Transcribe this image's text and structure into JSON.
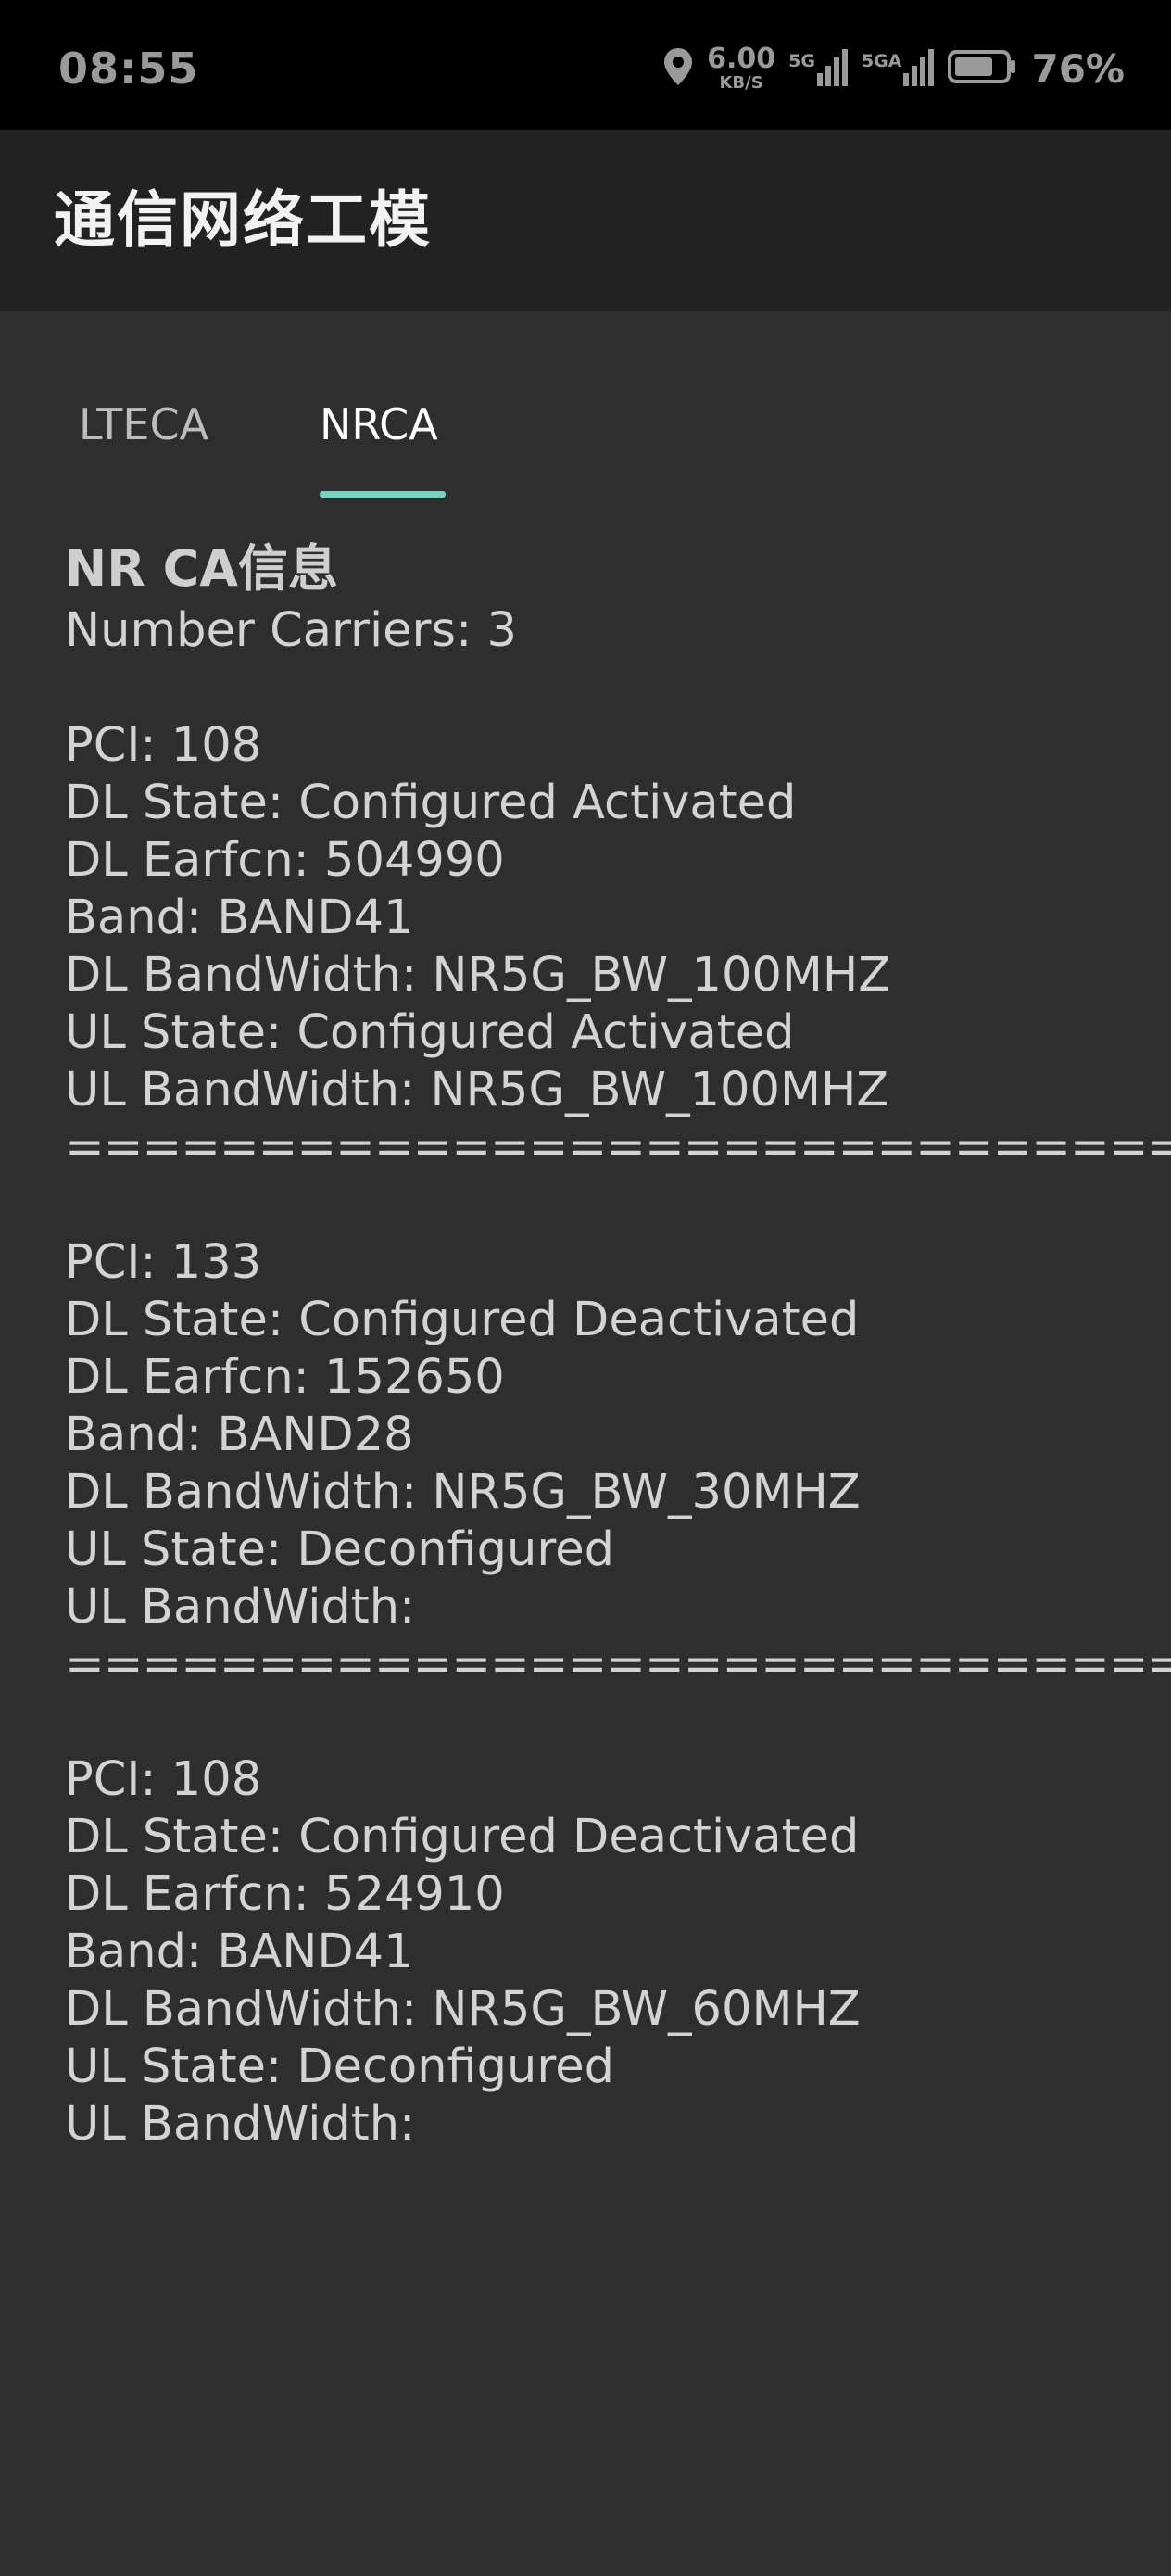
{
  "status_bar": {
    "time": "08:55",
    "speed_value": "6.00",
    "speed_unit": "KB/S",
    "net_label_1": "5G",
    "net_label_2": "5GA",
    "battery": "76%",
    "icons": [
      "location-icon",
      "signal-icon",
      "signal-icon",
      "battery-icon"
    ]
  },
  "app_bar": {
    "title": "通信网络工模"
  },
  "tabs": [
    {
      "label": "LTECA",
      "active": false
    },
    {
      "label": "NRCA",
      "active": true
    }
  ],
  "content": {
    "heading": "NR CA信息",
    "number_carriers": "Number Carriers: 3",
    "carriers": [
      {
        "pci": "PCI: 108",
        "dl_state": "DL State: Configured Activated",
        "dl_earfcn": "DL Earfcn: 504990",
        "band": "Band: BAND41",
        "dl_bandwidth": "DL BandWidth: NR5G_BW_100MHZ",
        "ul_state": "UL State: Configured Activated",
        "ul_bandwidth": "UL BandWidth: NR5G_BW_100MHZ",
        "separator": "=============================="
      },
      {
        "pci": "PCI: 133",
        "dl_state": "DL State: Configured Deactivated",
        "dl_earfcn": "DL Earfcn: 152650",
        "band": "Band: BAND28",
        "dl_bandwidth": "DL BandWidth: NR5G_BW_30MHZ",
        "ul_state": "UL State: Deconfigured",
        "ul_bandwidth": "UL BandWidth:",
        "separator": "=============================="
      },
      {
        "pci": "PCI: 108",
        "dl_state": "DL State: Configured Deactivated",
        "dl_earfcn": "DL Earfcn: 524910",
        "band": "Band: BAND41",
        "dl_bandwidth": "DL BandWidth: NR5G_BW_60MHZ",
        "ul_state": "UL State: Deconfigured",
        "ul_bandwidth": "UL BandWidth:"
      }
    ]
  },
  "colors": {
    "status_bar_bg": "#000000",
    "app_bar_bg": "#222222",
    "page_bg": "#2e2e2e",
    "tab_indicator": "#7ccfc3"
  }
}
